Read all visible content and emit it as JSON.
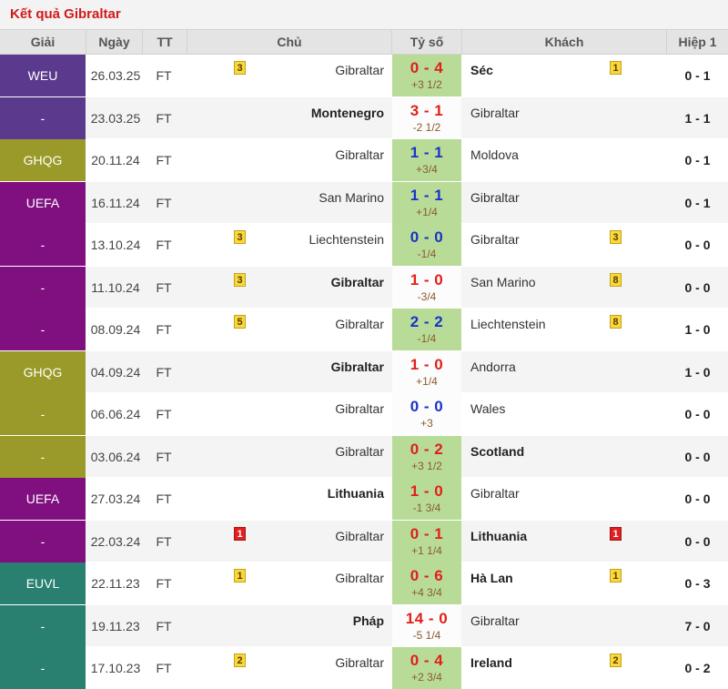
{
  "title": "Kết quả Gibraltar",
  "columns": {
    "league": "Giải",
    "date": "Ngày",
    "status": "TT",
    "home": "Chủ",
    "score": "Tỷ số",
    "away": "Khách",
    "half_time": "Hiệp 1"
  },
  "colors": {
    "title_red": "#d11a1a",
    "score_red": "#e0201b",
    "score_blue": "#1a33c7",
    "score_bg_green": "#b8dc98",
    "league_weu": "#5b3a8e",
    "league_uefa": "#800f80",
    "league_ghqg": "#9a9a2a",
    "league_euvl": "#2a8070",
    "card_yellow": "#f8d83c",
    "card_red": "#e02020"
  },
  "matches": [
    {
      "league": "WEU",
      "league_color": "#5b3a8e",
      "date": "26.03.25",
      "status": "FT",
      "home": "Gibraltar",
      "home_bold": false,
      "home_badge": "3",
      "home_badge_color": "yellow",
      "score": "0 - 4",
      "score_color": "red",
      "score_bg": "#b8dc98",
      "handicap": "+3 1/2",
      "away": "Séc",
      "away_bold": true,
      "away_badge": "1",
      "away_badge_color": "yellow",
      "half_time": "0 - 1"
    },
    {
      "league": "-",
      "league_color": "#5b3a8e",
      "date": "23.03.25",
      "status": "FT",
      "home": "Montenegro",
      "home_bold": true,
      "home_badge": "",
      "home_badge_color": "",
      "score": "3 - 1",
      "score_color": "red",
      "score_bg": "#fcfcfc",
      "handicap": "-2 1/2",
      "away": "Gibraltar",
      "away_bold": false,
      "away_badge": "",
      "away_badge_color": "",
      "half_time": "1 - 1"
    },
    {
      "league": "GHQG",
      "league_color": "#9a9a2a",
      "date": "20.11.24",
      "status": "FT",
      "home": "Gibraltar",
      "home_bold": false,
      "home_badge": "",
      "home_badge_color": "",
      "score": "1 - 1",
      "score_color": "blue",
      "score_bg": "#b8dc98",
      "handicap": "+3/4",
      "away": "Moldova",
      "away_bold": false,
      "away_badge": "",
      "away_badge_color": "",
      "half_time": "0 - 1"
    },
    {
      "league": "UEFA",
      "league_color": "#800f80",
      "date": "16.11.24",
      "status": "FT",
      "home": "San Marino",
      "home_bold": false,
      "home_badge": "",
      "home_badge_color": "",
      "score": "1 - 1",
      "score_color": "blue",
      "score_bg": "#b8dc98",
      "handicap": "+1/4",
      "away": "Gibraltar",
      "away_bold": false,
      "away_badge": "",
      "away_badge_color": "",
      "half_time": "0 - 1"
    },
    {
      "league": "-",
      "league_color": "#800f80",
      "date": "13.10.24",
      "status": "FT",
      "home": "Liechtenstein",
      "home_bold": false,
      "home_badge": "3",
      "home_badge_color": "yellow",
      "score": "0 - 0",
      "score_color": "blue",
      "score_bg": "#b8dc98",
      "handicap": "-1/4",
      "away": "Gibraltar",
      "away_bold": false,
      "away_badge": "3",
      "away_badge_color": "yellow",
      "half_time": "0 - 0"
    },
    {
      "league": "-",
      "league_color": "#800f80",
      "date": "11.10.24",
      "status": "FT",
      "home": "Gibraltar",
      "home_bold": true,
      "home_badge": "3",
      "home_badge_color": "yellow",
      "score": "1 - 0",
      "score_color": "red",
      "score_bg": "#fcfcfc",
      "handicap": "-3/4",
      "away": "San Marino",
      "away_bold": false,
      "away_badge": "8",
      "away_badge_color": "yellow",
      "half_time": "0 - 0"
    },
    {
      "league": "-",
      "league_color": "#800f80",
      "date": "08.09.24",
      "status": "FT",
      "home": "Gibraltar",
      "home_bold": false,
      "home_badge": "5",
      "home_badge_color": "yellow",
      "score": "2 - 2",
      "score_color": "blue",
      "score_bg": "#b8dc98",
      "handicap": "-1/4",
      "away": "Liechtenstein",
      "away_bold": false,
      "away_badge": "8",
      "away_badge_color": "yellow",
      "half_time": "1 - 0"
    },
    {
      "league": "GHQG",
      "league_color": "#9a9a2a",
      "date": "04.09.24",
      "status": "FT",
      "home": "Gibraltar",
      "home_bold": true,
      "home_badge": "",
      "home_badge_color": "",
      "score": "1 - 0",
      "score_color": "red",
      "score_bg": "#fcfcfc",
      "handicap": "+1/4",
      "away": "Andorra",
      "away_bold": false,
      "away_badge": "",
      "away_badge_color": "",
      "half_time": "1 - 0"
    },
    {
      "league": "-",
      "league_color": "#9a9a2a",
      "date": "06.06.24",
      "status": "FT",
      "home": "Gibraltar",
      "home_bold": false,
      "home_badge": "",
      "home_badge_color": "",
      "score": "0 - 0",
      "score_color": "blue",
      "score_bg": "#fcfcfc",
      "handicap": "+3",
      "away": "Wales",
      "away_bold": false,
      "away_badge": "",
      "away_badge_color": "",
      "half_time": "0 - 0"
    },
    {
      "league": "-",
      "league_color": "#9a9a2a",
      "date": "03.06.24",
      "status": "FT",
      "home": "Gibraltar",
      "home_bold": false,
      "home_badge": "",
      "home_badge_color": "",
      "score": "0 - 2",
      "score_color": "red",
      "score_bg": "#b8dc98",
      "handicap": "+3 1/2",
      "away": "Scotland",
      "away_bold": true,
      "away_badge": "",
      "away_badge_color": "",
      "half_time": "0 - 0"
    },
    {
      "league": "UEFA",
      "league_color": "#800f80",
      "date": "27.03.24",
      "status": "FT",
      "home": "Lithuania",
      "home_bold": true,
      "home_badge": "",
      "home_badge_color": "",
      "score": "1 - 0",
      "score_color": "red",
      "score_bg": "#b8dc98",
      "handicap": "-1 3/4",
      "away": "Gibraltar",
      "away_bold": false,
      "away_badge": "",
      "away_badge_color": "",
      "half_time": "0 - 0"
    },
    {
      "league": "-",
      "league_color": "#800f80",
      "date": "22.03.24",
      "status": "FT",
      "home": "Gibraltar",
      "home_bold": false,
      "home_badge": "1",
      "home_badge_color": "red",
      "score": "0 - 1",
      "score_color": "red",
      "score_bg": "#b8dc98",
      "handicap": "+1 1/4",
      "away": "Lithuania",
      "away_bold": true,
      "away_badge": "1",
      "away_badge_color": "red",
      "half_time": "0 - 0"
    },
    {
      "league": "EUVL",
      "league_color": "#2a8070",
      "date": "22.11.23",
      "status": "FT",
      "home": "Gibraltar",
      "home_bold": false,
      "home_badge": "1",
      "home_badge_color": "yellow",
      "score": "0 - 6",
      "score_color": "red",
      "score_bg": "#b8dc98",
      "handicap": "+4 3/4",
      "away": "Hà Lan",
      "away_bold": true,
      "away_badge": "1",
      "away_badge_color": "yellow",
      "half_time": "0 - 3"
    },
    {
      "league": "-",
      "league_color": "#2a8070",
      "date": "19.11.23",
      "status": "FT",
      "home": "Pháp",
      "home_bold": true,
      "home_badge": "",
      "home_badge_color": "",
      "score": "14 - 0",
      "score_color": "red",
      "score_bg": "#fcfcfc",
      "handicap": "-5 1/4",
      "away": "Gibraltar",
      "away_bold": false,
      "away_badge": "",
      "away_badge_color": "",
      "half_time": "7 - 0"
    },
    {
      "league": "-",
      "league_color": "#2a8070",
      "date": "17.10.23",
      "status": "FT",
      "home": "Gibraltar",
      "home_bold": false,
      "home_badge": "2",
      "home_badge_color": "yellow",
      "score": "0 - 4",
      "score_color": "red",
      "score_bg": "#b8dc98",
      "handicap": "+2 3/4",
      "away": "Ireland",
      "away_bold": true,
      "away_badge": "2",
      "away_badge_color": "yellow",
      "half_time": "0 - 2"
    }
  ]
}
